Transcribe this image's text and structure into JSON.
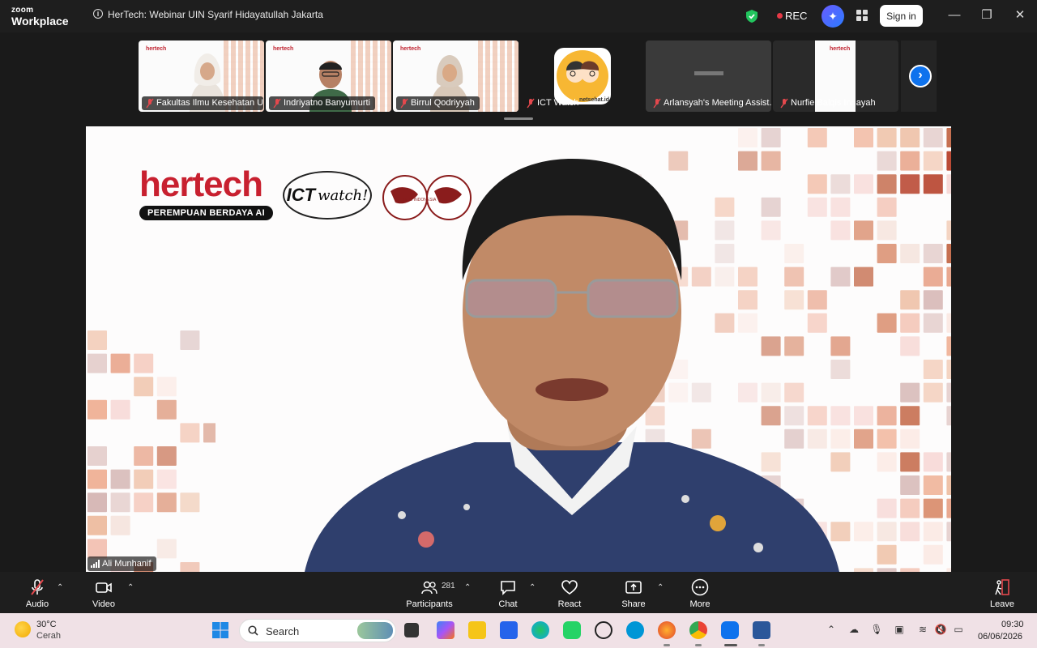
{
  "app": {
    "brand_top": "zoom",
    "brand_bottom": "Workplace",
    "meeting_title": "HerTech: Webinar UIN Syarif Hidayatullah Jakarta",
    "rec_label": "REC",
    "signin_label": "Sign in",
    "window_controls": {
      "minimize": "—",
      "restore": "❐",
      "close": "✕"
    }
  },
  "thumbnails": [
    {
      "name": "Fakultas Ilmu Kesehatan UI...",
      "muted": true,
      "type": "video"
    },
    {
      "name": "Indriyatno Banyumurti",
      "muted": true,
      "type": "video"
    },
    {
      "name": "Birrul Qodriyyah",
      "muted": true,
      "type": "video"
    },
    {
      "name": "ICT Watch",
      "muted": true,
      "type": "avatar",
      "avatar_text": "netsehat.id"
    },
    {
      "name": "Arlansyah's Meeting Assist...",
      "muted": true,
      "type": "screen"
    },
    {
      "name": "Nurfie Balqis Innayah",
      "muted": true,
      "type": "video"
    }
  ],
  "thumb_logo": "hertech",
  "main_video": {
    "speaker_name": "Ali Munhanif",
    "logo_text": "hertech",
    "logo_tagline": "PEREMPUAN BERDAYA AI",
    "ict_text": "ICT",
    "ict_sub": "watch!",
    "bpw_text": "BPW INDONESIA"
  },
  "controls": {
    "audio": "Audio",
    "video": "Video",
    "participants": "Participants",
    "participant_count": "281",
    "chat": "Chat",
    "react": "React",
    "share": "Share",
    "more": "More",
    "leave": "Leave"
  },
  "taskbar": {
    "weather_temp": "30°C",
    "weather_condition": "Cerah",
    "search_placeholder": "Search",
    "time": "09:30",
    "date": "06/06/2026"
  },
  "colors": {
    "accent_blue": "#0e72ed",
    "hertech_red": "#c8202f",
    "rec_red": "#e63946",
    "muted_red": "#e5484d",
    "leave_red": "#e5484d"
  }
}
